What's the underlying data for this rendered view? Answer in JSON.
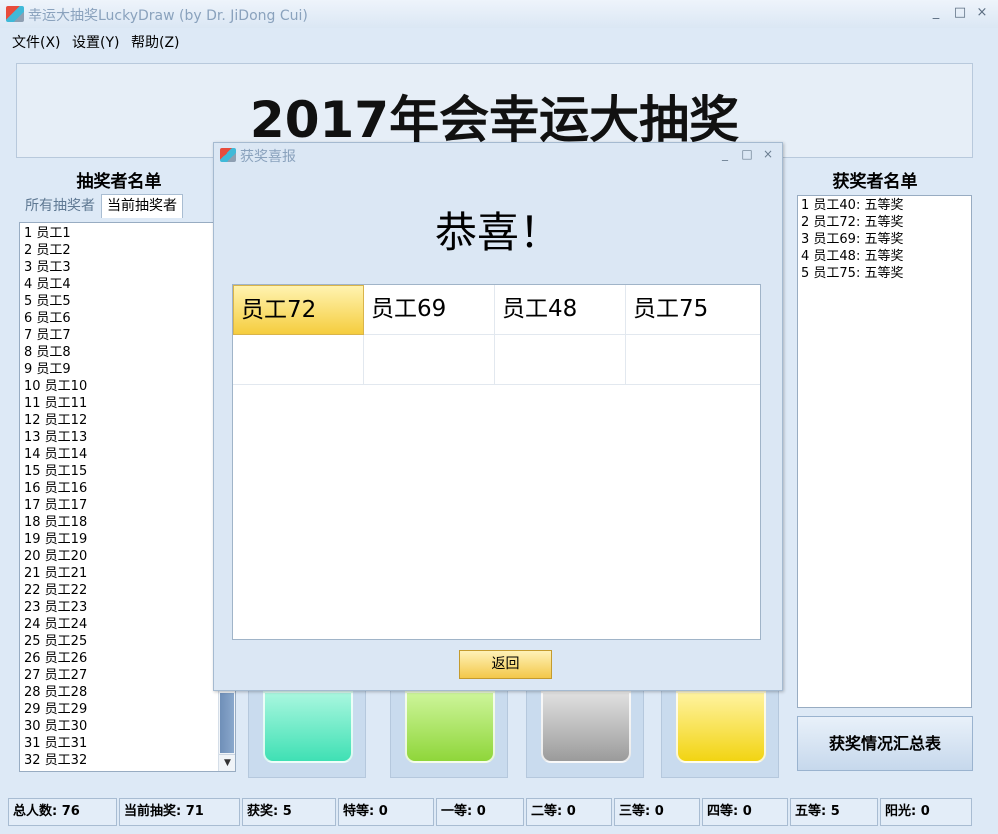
{
  "window": {
    "title": "幸运大抽奖LuckyDraw (by Dr. JiDong Cui)",
    "minimize": "_",
    "maximize": "□",
    "close": "×"
  },
  "menu": [
    "文件(X)",
    "设置(Y)",
    "帮助(Z)"
  ],
  "banner": {
    "title": "2017年会幸运大抽奖"
  },
  "left_panel": {
    "title": "抽奖者名单",
    "tabs": [
      "所有抽奖者",
      "当前抽奖者"
    ],
    "active_tab": 1,
    "entries": [
      "1 员工1",
      "2 员工2",
      "3 员工3",
      "4 员工4",
      "5 员工5",
      "6 员工6",
      "7 员工7",
      "8 员工8",
      "9 员工9",
      "10 员工10",
      "11 员工11",
      "12 员工12",
      "13 员工13",
      "14 员工14",
      "15 员工15",
      "16 员工16",
      "17 员工17",
      "18 员工18",
      "19 员工19",
      "20 员工20",
      "21 员工21",
      "22 员工22",
      "23 员工23",
      "24 员工24",
      "25 员工25",
      "26 员工26",
      "27 员工27",
      "28 员工28",
      "29 员工29",
      "30 员工30",
      "31 员工31",
      "32 员工32"
    ]
  },
  "right_panel": {
    "title": "获奖者名单",
    "winners": [
      "1 员工40: 五等奖",
      "2 员工72: 五等奖",
      "3 员工69: 五等奖",
      "4 员工48: 五等奖",
      "5 员工75: 五等奖"
    ],
    "summary_button": "获奖情况汇总表"
  },
  "prize_slot_colors": [
    "#3fe0b4",
    "#8fd63a",
    "#9b9b9b",
    "#f2d412"
  ],
  "status": [
    {
      "label": "总人数",
      "value": "76"
    },
    {
      "label": "当前抽奖",
      "value": "71"
    },
    {
      "label": "获奖",
      "value": "5"
    },
    {
      "label": "特等",
      "value": "0"
    },
    {
      "label": "一等",
      "value": "0"
    },
    {
      "label": "二等",
      "value": "0"
    },
    {
      "label": "三等",
      "value": "0"
    },
    {
      "label": "四等",
      "value": "0"
    },
    {
      "label": "五等",
      "value": "5"
    },
    {
      "label": "阳光",
      "value": "0"
    }
  ],
  "dialog": {
    "title": "获奖喜报",
    "heading": "恭喜！",
    "winners": [
      "员工72",
      "员工69",
      "员工48",
      "员工75"
    ],
    "selected_index": 0,
    "return_button": "返回"
  }
}
